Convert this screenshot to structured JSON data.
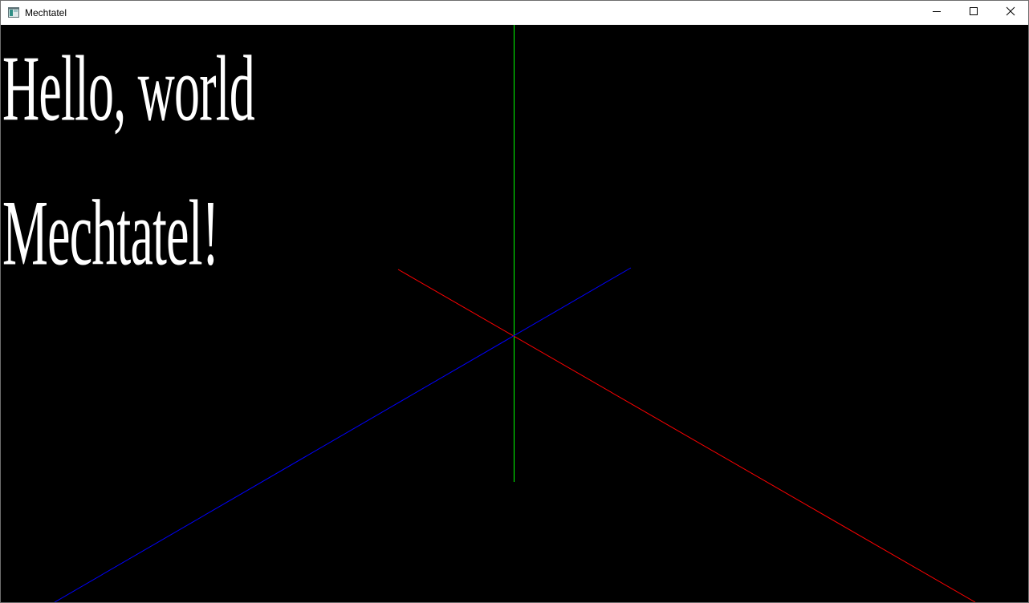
{
  "window": {
    "title": "Mechtatel",
    "icon": "app-window-icon",
    "controls": {
      "minimize": "minimize-icon",
      "maximize": "maximize-icon",
      "close": "close-icon"
    }
  },
  "scene": {
    "background_color": "#000000",
    "text_color": "#ffffff",
    "text_lines": [
      "Hello, world",
      "Mechtatel!"
    ],
    "axes": [
      {
        "name": "x-axis",
        "color": "#ff0000"
      },
      {
        "name": "y-axis",
        "color": "#00ff00"
      },
      {
        "name": "z-axis",
        "color": "#0000ff"
      }
    ]
  }
}
